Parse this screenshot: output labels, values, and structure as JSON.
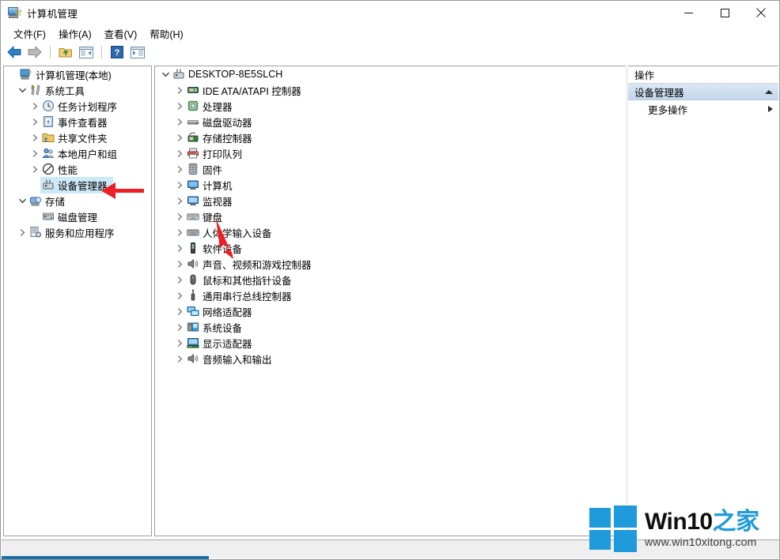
{
  "window": {
    "title": "计算机管理",
    "icon": "computer-management-icon",
    "minimize_label": "—",
    "maximize_label": "□",
    "close_label": "✕"
  },
  "menubar": {
    "items": [
      {
        "label": "文件(F)",
        "name": "menu-file"
      },
      {
        "label": "操作(A)",
        "name": "menu-action"
      },
      {
        "label": "查看(V)",
        "name": "menu-view"
      },
      {
        "label": "帮助(H)",
        "name": "menu-help"
      }
    ]
  },
  "toolbar": {
    "buttons": [
      {
        "name": "back-button",
        "icon": "back-arrow-icon",
        "title": "后退"
      },
      {
        "name": "forward-button",
        "icon": "forward-arrow-icon",
        "title": "前进"
      },
      {
        "name": "up-folder-button",
        "icon": "folder-up-icon",
        "title": "上移一级"
      },
      {
        "name": "show-pane-button",
        "icon": "console-pane-icon",
        "title": "显示/隐藏控制台树"
      },
      {
        "name": "help-button",
        "icon": "question-mark-icon",
        "title": "帮助"
      },
      {
        "name": "action-pane-button",
        "icon": "action-pane-icon",
        "title": "显示/隐藏操作窗格"
      }
    ]
  },
  "left_tree": {
    "items": [
      {
        "label": "计算机管理(本地)",
        "indent": 0,
        "expander": "none",
        "icon": "computer-management-icon",
        "selected": false
      },
      {
        "label": "系统工具",
        "indent": 1,
        "expander": "expanded",
        "icon": "system-tools-icon",
        "selected": false
      },
      {
        "label": "任务计划程序",
        "indent": 2,
        "expander": "collapsed",
        "icon": "task-scheduler-icon",
        "selected": false
      },
      {
        "label": "事件查看器",
        "indent": 2,
        "expander": "collapsed",
        "icon": "event-viewer-icon",
        "selected": false
      },
      {
        "label": "共享文件夹",
        "indent": 2,
        "expander": "collapsed",
        "icon": "shared-folders-icon",
        "selected": false
      },
      {
        "label": "本地用户和组",
        "indent": 2,
        "expander": "collapsed",
        "icon": "local-users-groups-icon",
        "selected": false
      },
      {
        "label": "性能",
        "indent": 2,
        "expander": "collapsed",
        "icon": "performance-icon",
        "selected": false
      },
      {
        "label": "设备管理器",
        "indent": 2,
        "expander": "none",
        "icon": "device-manager-icon",
        "selected": true
      },
      {
        "label": "存储",
        "indent": 1,
        "expander": "expanded",
        "icon": "storage-icon",
        "selected": false
      },
      {
        "label": "磁盘管理",
        "indent": 2,
        "expander": "none",
        "icon": "disk-management-icon",
        "selected": false
      },
      {
        "label": "服务和应用程序",
        "indent": 1,
        "expander": "collapsed",
        "icon": "services-applications-icon",
        "selected": false
      }
    ]
  },
  "device_tree": {
    "root": {
      "label": "DESKTOP-8E5SLCH",
      "expander": "expanded",
      "icon": "computer-node-icon"
    },
    "items": [
      {
        "label": "IDE ATA/ATAPI 控制器",
        "icon": "ide-controller-icon"
      },
      {
        "label": "处理器",
        "icon": "processor-icon"
      },
      {
        "label": "磁盘驱动器",
        "icon": "disk-drive-icon"
      },
      {
        "label": "存储控制器",
        "icon": "storage-controller-icon"
      },
      {
        "label": "打印队列",
        "icon": "print-queue-icon"
      },
      {
        "label": "固件",
        "icon": "firmware-icon"
      },
      {
        "label": "计算机",
        "icon": "computer-icon"
      },
      {
        "label": "监视器",
        "icon": "monitor-icon"
      },
      {
        "label": "键盘",
        "icon": "keyboard-icon"
      },
      {
        "label": "人体学输入设备",
        "icon": "hid-icon"
      },
      {
        "label": "软件设备",
        "icon": "software-device-icon"
      },
      {
        "label": "声音、视频和游戏控制器",
        "icon": "sound-video-game-icon"
      },
      {
        "label": "鼠标和其他指针设备",
        "icon": "mouse-icon"
      },
      {
        "label": "通用串行总线控制器",
        "icon": "usb-controller-icon"
      },
      {
        "label": "网络适配器",
        "icon": "network-adapter-icon"
      },
      {
        "label": "系统设备",
        "icon": "system-device-icon"
      },
      {
        "label": "显示适配器",
        "icon": "display-adapter-icon"
      },
      {
        "label": "音频输入和输出",
        "icon": "audio-io-icon"
      }
    ]
  },
  "actions_pane": {
    "header": "操作",
    "section_title": "设备管理器",
    "section_chevron": "chevron-up-icon",
    "more_actions": "更多操作",
    "more_actions_chevron": "chevron-right-icon"
  },
  "annotations": {
    "arrow_color": "#ec2024",
    "arrows": [
      {
        "name": "arrow-to-device-manager",
        "points_to": "设备管理器"
      },
      {
        "name": "arrow-to-keyboard-area",
        "points_to": "键盘"
      }
    ]
  },
  "watermark": {
    "brand_dark": "Win10",
    "brand_accent": "之家",
    "url": "www.win10xitong.com",
    "logo": "windows-logo-icon",
    "accent_color": "#1f9ada"
  }
}
